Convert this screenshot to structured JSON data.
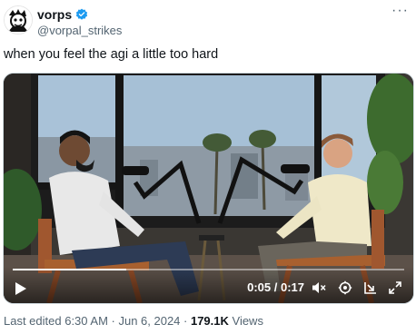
{
  "author": {
    "display_name": "vorps",
    "handle": "@vorpal_strikes",
    "verified": true,
    "avatar_icon": "avatar-drawing"
  },
  "menu_icon": "more-options-icon",
  "tweet": {
    "text": "when you feel the agi a little too hard"
  },
  "video": {
    "time_display": "0:05 / 0:17",
    "progress": 0.29,
    "icons": [
      "play-icon",
      "mute-icon",
      "settings-icon",
      "popout-icon",
      "fullscreen-icon"
    ]
  },
  "meta": {
    "edited_label": "Last edited 6:30 AM · Jun 6, 2024 · ",
    "views_count": "179.1K",
    "views_label": " Views"
  },
  "colors": {
    "text_primary": "#0f1419",
    "text_secondary": "#536471",
    "verified_blue": "#1d9bf0"
  }
}
